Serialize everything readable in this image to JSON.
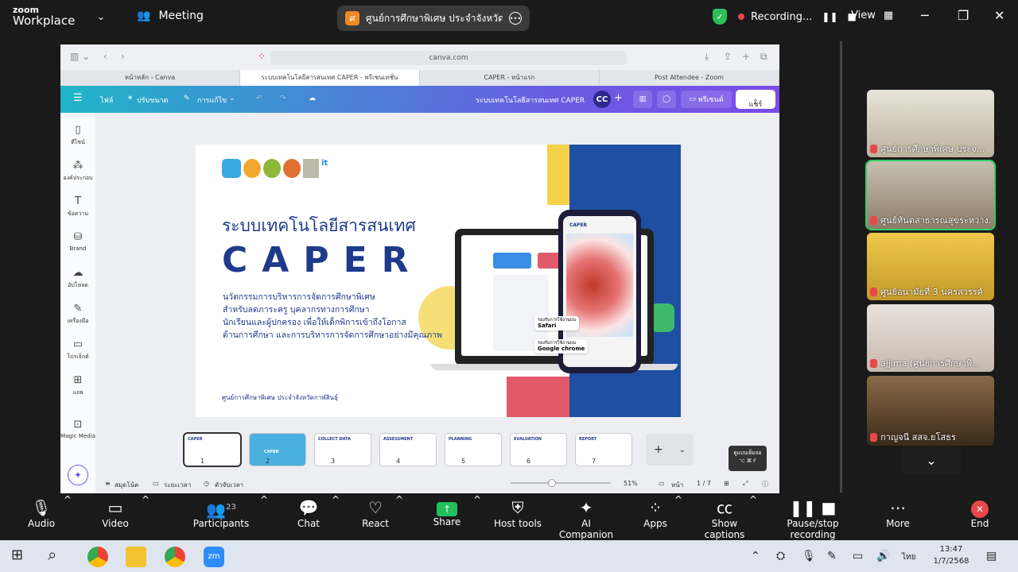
{
  "zoom": {
    "brand_top": "zoom",
    "brand_bottom": "Workplace",
    "meeting_label": "Meeting",
    "share_badge": "ศ",
    "share_title": "ศูนย์การศึกษาพิเศษ ประจำจังหวัดกาฬสิ",
    "recording_label": "Recording...",
    "view_label": "View"
  },
  "browser": {
    "url": "canva.com",
    "tabs": [
      {
        "label": "หน้าหลัก - Canva"
      },
      {
        "label": "ระบบเทคโนโลยีสารสนเทศ CAPER - พรีเซนเทชั่น"
      },
      {
        "label": "CAPER - หน้าแรก"
      },
      {
        "label": "Post Attendee - Zoom"
      }
    ]
  },
  "canva": {
    "menu_file": "ไฟล์",
    "menu_resize": "ปรับขนาด",
    "menu_edit": "การแก้ไข",
    "doc_title": "ระบบเทคโนโลยีสารสนเทศ CAPER",
    "avatar_initials": "CC",
    "present_label": "พรีเซนต์",
    "share_label": "แชร์",
    "sidebar": [
      {
        "label": "ดีไซน์",
        "icon": "design-icon"
      },
      {
        "label": "องค์ประกอบ",
        "icon": "elements-icon"
      },
      {
        "label": "ข้อความ",
        "icon": "text-icon"
      },
      {
        "label": "Brand",
        "icon": "brand-icon"
      },
      {
        "label": "อัปโหลด",
        "icon": "upload-icon"
      },
      {
        "label": "เครื่องมือ",
        "icon": "tools-icon"
      },
      {
        "label": "โปรเจ็กต์",
        "icon": "projects-icon"
      },
      {
        "label": "แอพ",
        "icon": "apps-icon"
      },
      {
        "label": "Magic Media",
        "icon": "magic-media-icon"
      }
    ],
    "slide": {
      "title": "ระบบเทคโนโลยีสารสนเทศ",
      "big": "CAPER",
      "desc1": "นวัตกรรมการบริหารการจัดการศึกษาพิเศษ",
      "desc2": "สำหรับลดภาระครู บุคลากรทางการศึกษา",
      "desc3": "นักเรียนและผู้ปกครอง เพื่อให้เด็กพิการเข้าถึงโอกาส",
      "desc4": "ด้านการศึกษา และการบริหารการจัดการศึกษาอย่างมีคุณภาพ",
      "footer": "ศูนย์การศึกษาพิเศษ ประจำจังหวัดกาฬสินธุ์",
      "safari_label": "รองรับการใช้งานบน",
      "safari_name": "Safari",
      "chrome_label": "รองรับการใช้งานบน",
      "chrome_name": "Google chrome",
      "phone_brand": "CAPER"
    },
    "thumbnails": [
      {
        "num": "1",
        "label": "CAPER"
      },
      {
        "num": "2",
        "label": "CAPER"
      },
      {
        "num": "3",
        "label": "COLLECT DATA"
      },
      {
        "num": "4",
        "label": "ASSESSMENT"
      },
      {
        "num": "5",
        "label": "PLANNING"
      },
      {
        "num": "6",
        "label": "EVALUATION"
      },
      {
        "num": "7",
        "label": "REPORT"
      }
    ],
    "notes_label": "สมุดโน้ต",
    "duration_label": "ระยะเวลา",
    "timer_label": "ตัวจับเวลา",
    "zoom_pct": 51,
    "zoom_text": "51%",
    "page_label": "หน้า",
    "page_count": "1 / 7",
    "tooltip_title": "ดูแบบเต็มจอ",
    "tooltip_keys": "⌥ ⌘ F"
  },
  "gallery": [
    {
      "name": "ศูนย์การศึกษาพิเศษ ประจ...",
      "bg": "#c9bfae"
    },
    {
      "name": "ศูนย์ทันตสาธารณสุขระหว่าง...",
      "bg": "#a89a88"
    },
    {
      "name": "ศูนย์อนามัยที่ 3 นครสวรรค์",
      "bg": "#e3b93a"
    },
    {
      "name": "ajjima (ศูนย์การศึกษาพิ...",
      "bg": "#d8cfc8"
    },
    {
      "name": "กาญจนี สสจ.ยโสธร",
      "bg": "#7a5a3a"
    }
  ],
  "toolbar": {
    "audio": "Audio",
    "video": "Video",
    "participants": "Participants",
    "participants_count": "23",
    "chat": "Chat",
    "react": "React",
    "share": "Share",
    "host_tools": "Host tools",
    "ai_companion": "AI Companion",
    "apps": "Apps",
    "captions": "Show captions",
    "pause_rec": "Pause/stop recording",
    "more": "More",
    "end": "End"
  },
  "taskbar": {
    "lang": "ไทย",
    "time": "13:47",
    "date": "1/7/2568"
  }
}
